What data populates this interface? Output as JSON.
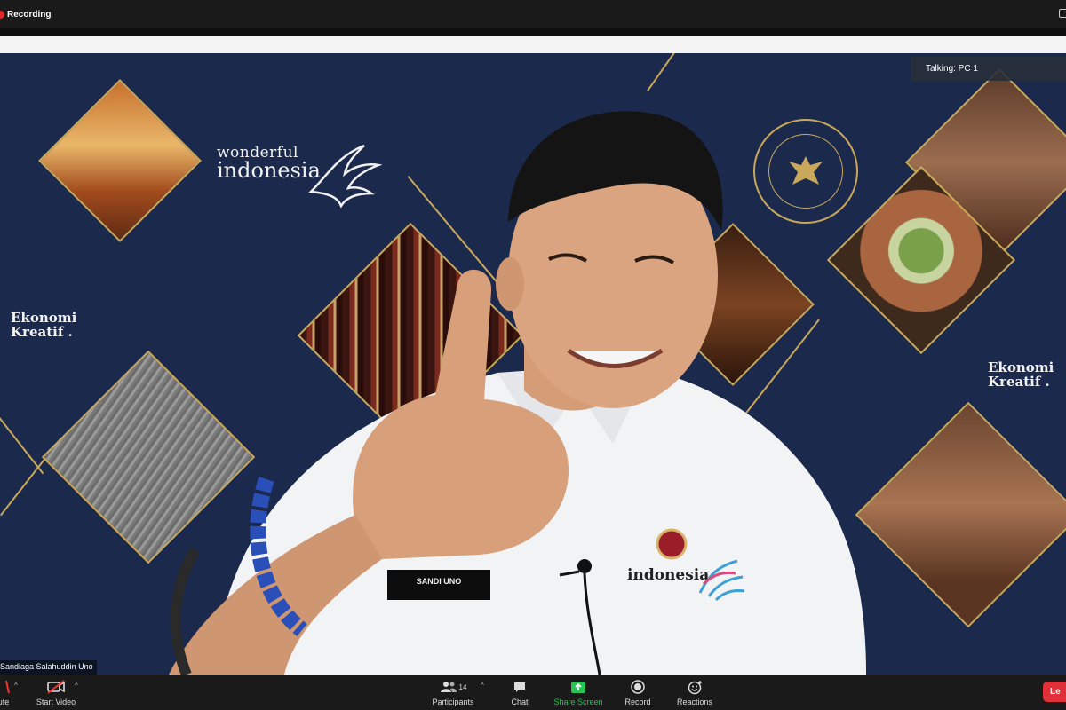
{
  "window": {
    "recording_label": "Recording"
  },
  "video": {
    "talking_label": "Talking: PC 1",
    "participant_name": "Sandiaga Salahuddin Uno",
    "background": {
      "brand_line1": "wonderful",
      "brand_line2": "indonesia",
      "ekonomi_line1": "Ekonomi",
      "ekonomi_line2": "Kreatif .",
      "name_badge": "SANDI UNO",
      "shirt_logo": "indonesia"
    }
  },
  "toolbar": {
    "mute_label": "ute",
    "start_video_label": "Start Video",
    "participants_label": "Participants",
    "participants_count": "14",
    "chat_label": "Chat",
    "share_screen_label": "Share Screen",
    "record_label": "Record",
    "reactions_label": "Reactions",
    "leave_label": "Le"
  },
  "colors": {
    "background_navy": "#1b2a4c",
    "gold_accent": "#c9a85c",
    "share_green": "#2bc25a",
    "leave_red": "#e0313a",
    "recording_red": "#e02828"
  }
}
